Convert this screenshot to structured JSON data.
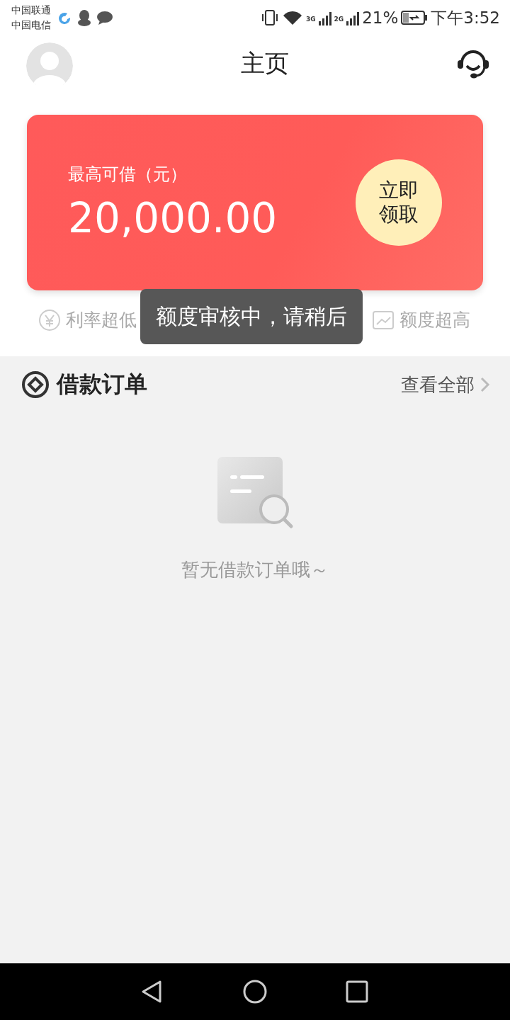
{
  "status_bar": {
    "carriers": [
      "中国联通",
      "中国电信"
    ],
    "network_labels": [
      "3G",
      "2G"
    ],
    "battery": "21%",
    "time": "下午3:52"
  },
  "header": {
    "title": "主页"
  },
  "credit_card": {
    "label": "最高可借（元）",
    "amount": "20,000.00",
    "action": "立即领取"
  },
  "features": [
    {
      "label": "利率超低",
      "kind": "yen"
    },
    {
      "label": "额度超高",
      "kind": "chart"
    }
  ],
  "toast": "额度审核中，请稍后",
  "orders": {
    "title": "借款订单",
    "view_all": "查看全部",
    "empty_text": "暂无借款订单哦～"
  }
}
